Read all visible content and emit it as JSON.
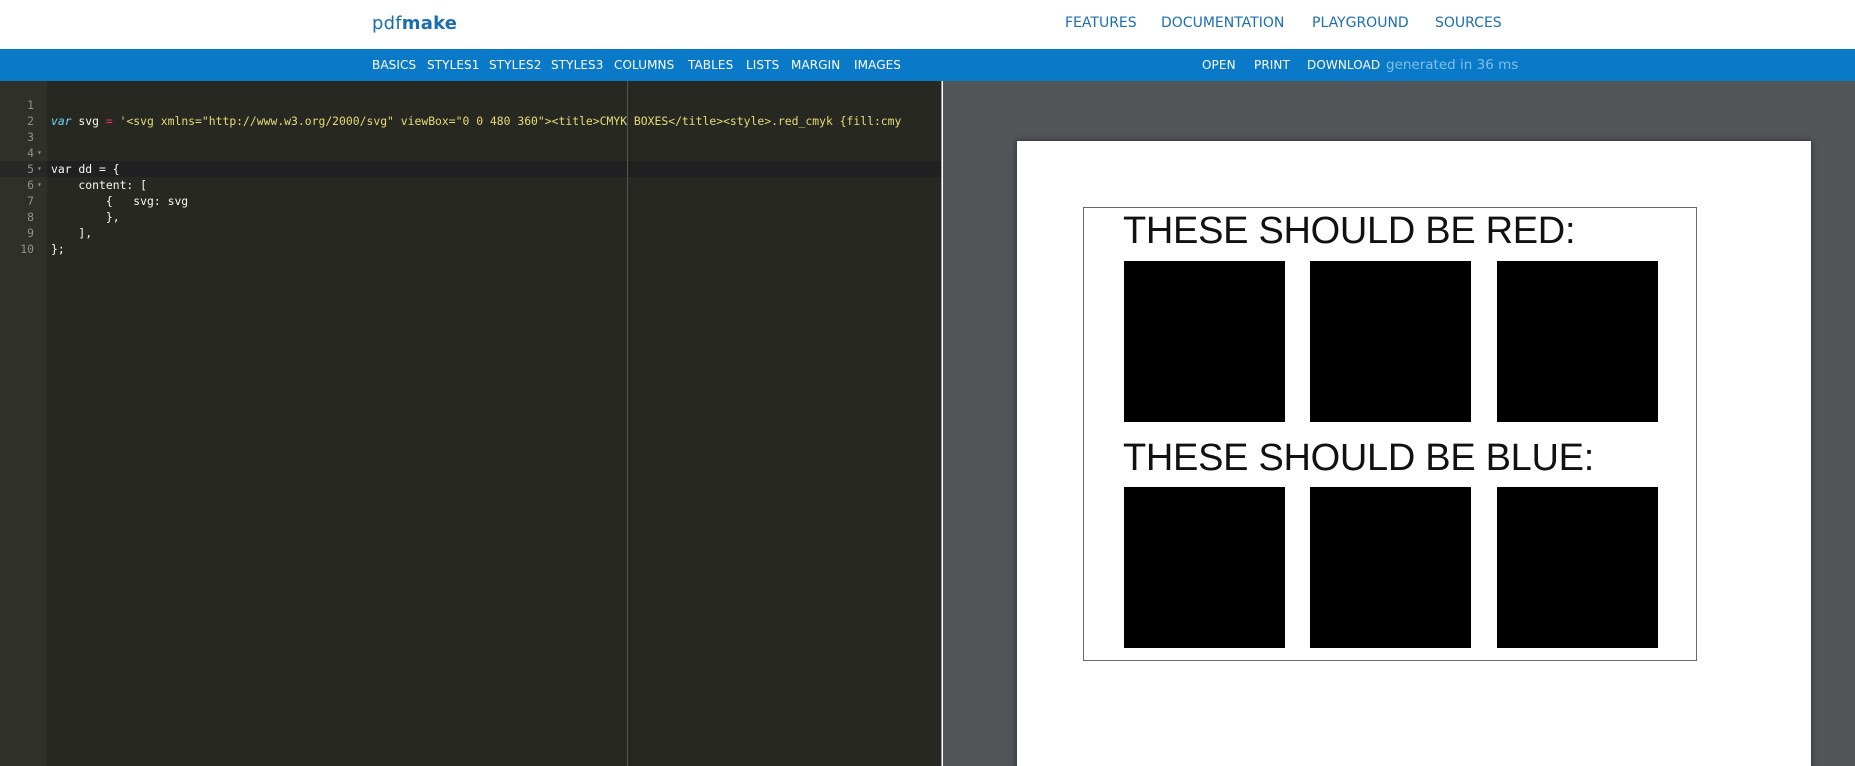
{
  "header": {
    "logo_light": "pdf",
    "logo_bold": "make",
    "nav": [
      "FEATURES",
      "DOCUMENTATION",
      "PLAYGROUND",
      "SOURCES"
    ]
  },
  "toolbar": {
    "examples": [
      "BASICS",
      "STYLES1",
      "STYLES2",
      "STYLES3",
      "COLUMNS",
      "TABLES",
      "LISTS",
      "MARGIN",
      "IMAGES"
    ],
    "actions": [
      "OPEN",
      "PRINT",
      "DOWNLOAD"
    ],
    "status": "generated in 36 ms"
  },
  "editor": {
    "lines": [
      {
        "num": "1",
        "fold": "",
        "code": "var svg = '<svg xmlns=\"http://www.w3.org/2000/svg\" viewBox=\"0 0 480 360\"><title>CMYK BOXES</title><style>.red_cmyk {fill:cmy"
      },
      {
        "num": "2",
        "fold": "",
        "code": ""
      },
      {
        "num": "3",
        "fold": "▾",
        "code": "var dd = {"
      },
      {
        "num": "4",
        "fold": "▾",
        "code": "    content: ["
      },
      {
        "num": "5",
        "fold": "▾",
        "code": "        {"
      },
      {
        "num": "6",
        "fold": "",
        "code": "            svg: svg"
      },
      {
        "num": "7",
        "fold": "",
        "code": "        },"
      },
      {
        "num": "8",
        "fold": "",
        "code": "    ],"
      },
      {
        "num": "9",
        "fold": "",
        "code": "};"
      },
      {
        "num": "10",
        "fold": "",
        "code": ""
      }
    ]
  },
  "preview": {
    "heading_red": "THESE SHOULD BE RED:",
    "heading_blue": "THESE SHOULD BE BLUE:",
    "box_fill": "#000000"
  },
  "colors": {
    "brand_blue": "#0a79c8",
    "link_blue": "#1a6fb0",
    "editor_bg": "#272822",
    "preview_bg": "#525659"
  }
}
